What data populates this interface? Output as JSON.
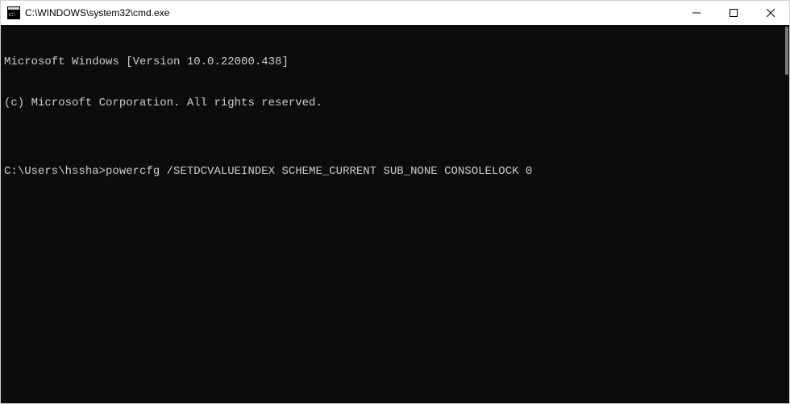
{
  "titlebar": {
    "title": "C:\\WINDOWS\\system32\\cmd.exe"
  },
  "terminal": {
    "lines": [
      "Microsoft Windows [Version 10.0.22000.438]",
      "(c) Microsoft Corporation. All rights reserved.",
      ""
    ],
    "prompt": "C:\\Users\\hssha>",
    "command": "powercfg /SETDCVALUEINDEX SCHEME_CURRENT SUB_NONE CONSOLELOCK 0"
  }
}
